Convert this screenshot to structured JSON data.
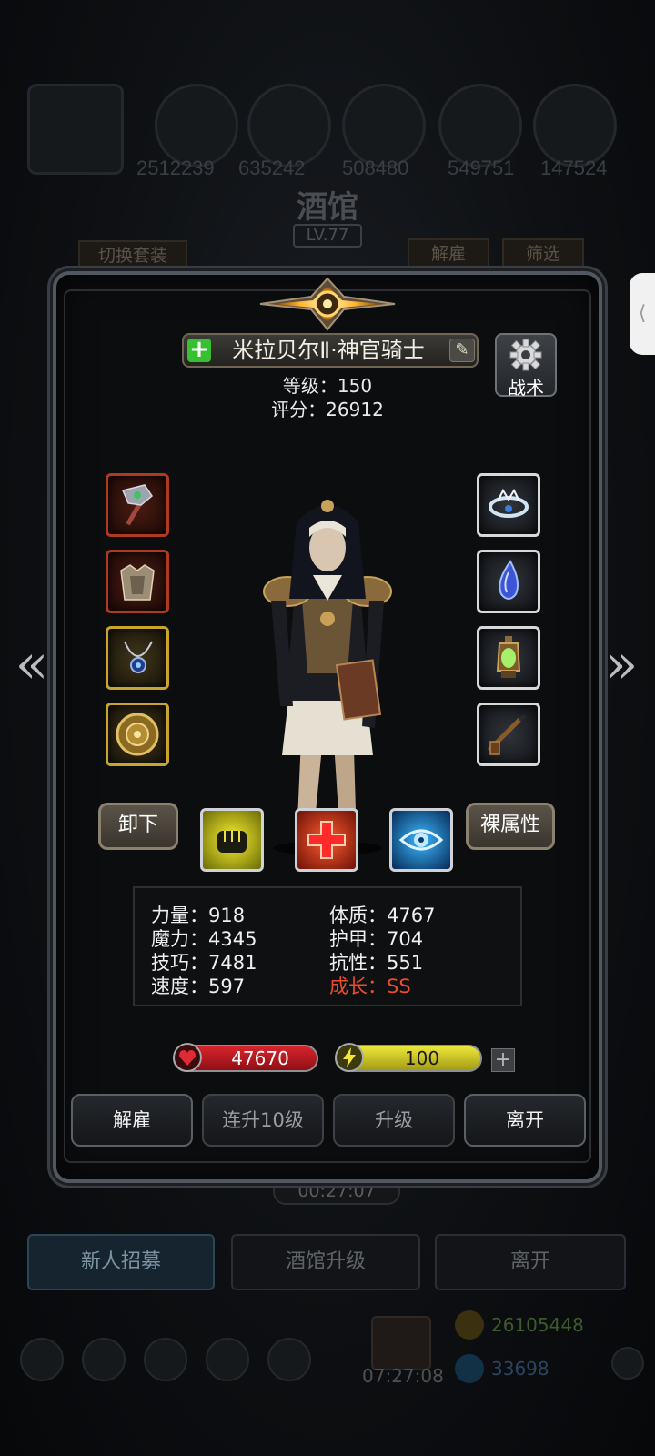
{
  "background": {
    "resources": [
      "2512239",
      "635242",
      "508480",
      "549751",
      "147524"
    ],
    "title": "酒馆",
    "level": "LV.77",
    "switch_set_label": "切换套装",
    "dismiss_label": "解雇",
    "filter_label": "筛选",
    "timer": "00:27:07",
    "tabs": [
      "新人招募",
      "酒馆升级",
      "离开"
    ],
    "gift_timer": "07:27:08",
    "gold": "26105448",
    "gems": "33698"
  },
  "hero": {
    "name": "米拉贝尔Ⅱ·神官骑士",
    "level_line": "等级：150",
    "score_line": "评分：26912",
    "tactics_label": "战术"
  },
  "equipment": {
    "left": [
      "war-hammer",
      "chest-armor",
      "amulet",
      "round-shield"
    ],
    "right": [
      "silver-tiara",
      "blue-crystal",
      "green-lantern",
      "smoking-pipe"
    ]
  },
  "buttons": {
    "unequip": "卸下",
    "base_attributes": "裸属性"
  },
  "skills": [
    "fist-skill",
    "heal-cross-skill",
    "eye-skill"
  ],
  "stats": {
    "strength": "力量：918",
    "magic": "魔力：4345",
    "skill": "技巧：7481",
    "speed": "速度：597",
    "constitution": "体质：4767",
    "armor": "护甲：704",
    "resistance": "抗性：551",
    "growth": "成长：SS"
  },
  "bars": {
    "hp": "47670",
    "energy": "100"
  },
  "actions": [
    "解雇",
    "连升10级",
    "升级",
    "离开"
  ],
  "colors": {
    "growth": "#e84d2e",
    "hp": "#d7242c",
    "energy": "#ece53a"
  }
}
